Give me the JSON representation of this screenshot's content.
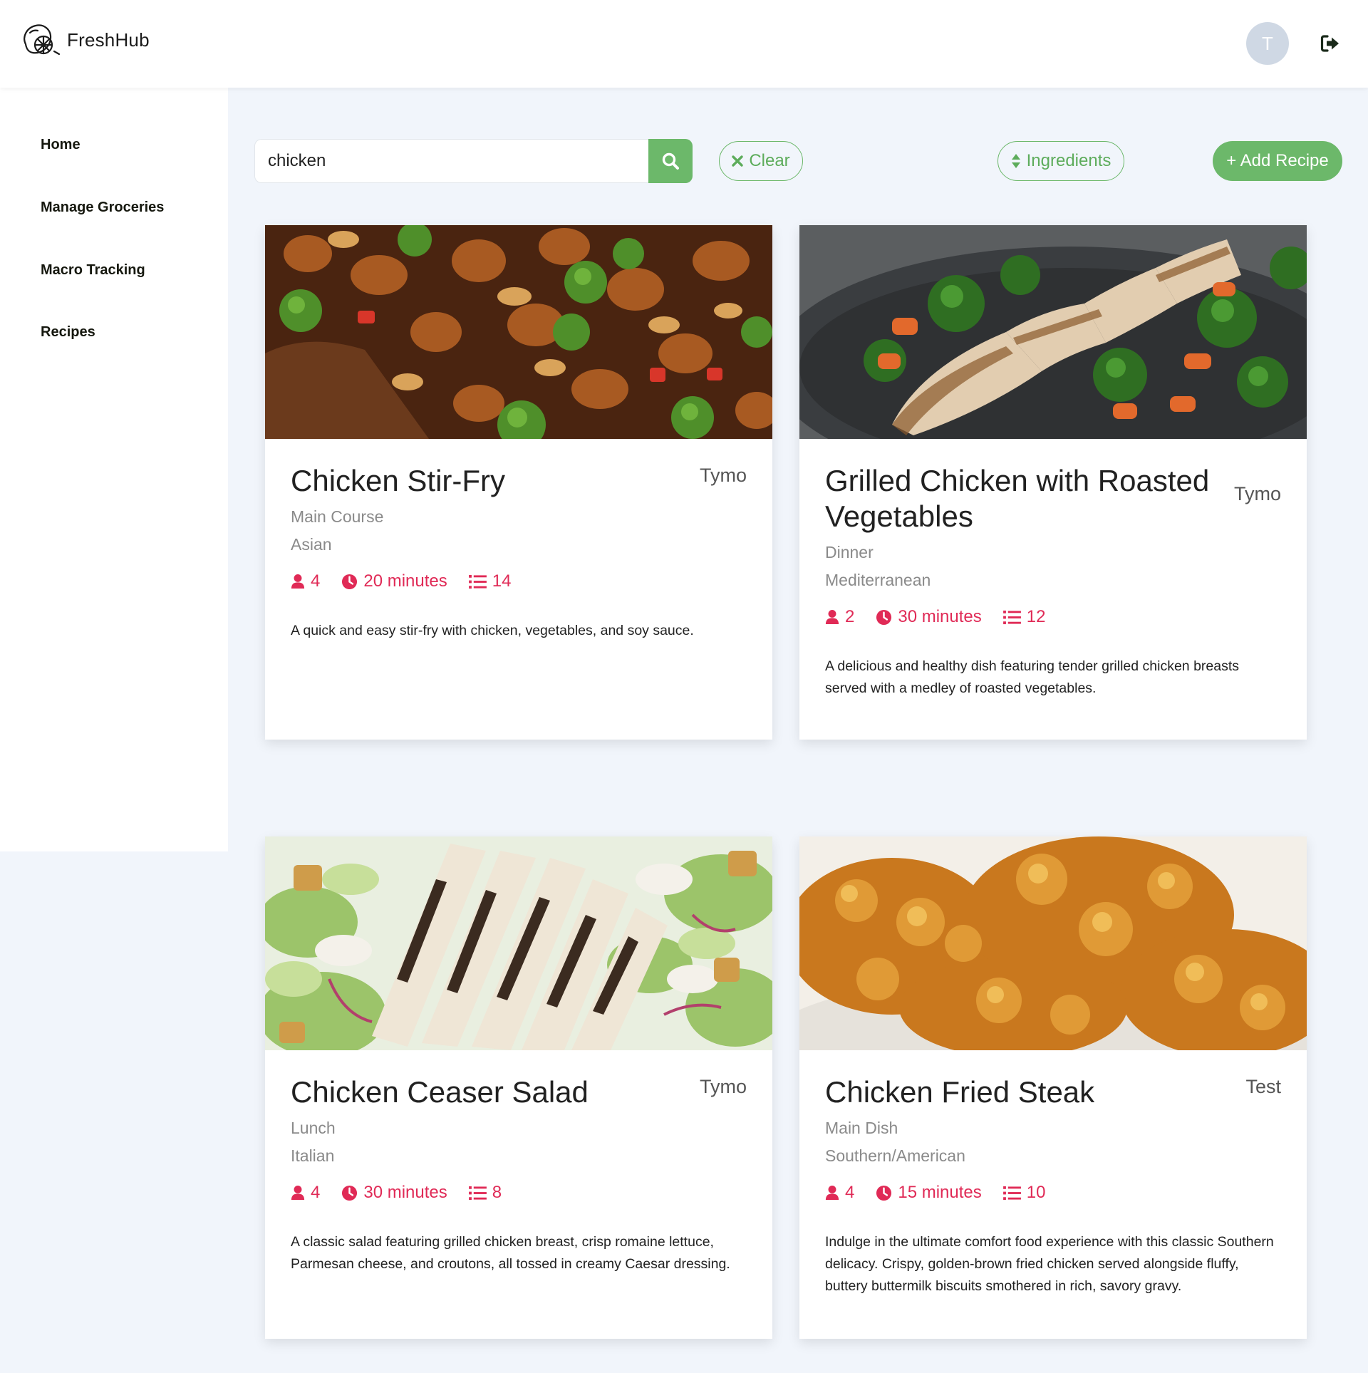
{
  "app": {
    "name": "FreshHub",
    "user_initial": "T"
  },
  "sidebar": {
    "items": [
      {
        "label": "Home"
      },
      {
        "label": "Manage Groceries"
      },
      {
        "label": "Macro Tracking"
      },
      {
        "label": "Recipes"
      }
    ]
  },
  "toolbar": {
    "search_value": "chicken",
    "clear_label": "Clear",
    "ingredients_label": "Ingredients",
    "add_label": "+ Add Recipe"
  },
  "recipes": [
    {
      "title": "Chicken Stir-Fry",
      "author": "Tymo",
      "category": "Main Course",
      "cuisine": "Asian",
      "servings": "4",
      "time": "20 minutes",
      "ingredients": "14",
      "description": "A quick and easy stir-fry with chicken, vegetables, and soy sauce."
    },
    {
      "title": "Grilled Chicken with Roasted Vegetables",
      "author": "Tymo",
      "category": "Dinner",
      "cuisine": "Mediterranean",
      "servings": "2",
      "time": "30 minutes",
      "ingredients": "12",
      "description": "A delicious and healthy dish featuring tender grilled chicken breasts served with a medley of roasted vegetables."
    },
    {
      "title": "Chicken Ceaser Salad",
      "author": "Tymo",
      "category": "Lunch",
      "cuisine": "Italian",
      "servings": "4",
      "time": "30 minutes",
      "ingredients": "8",
      "description": "A classic salad featuring grilled chicken breast, crisp romaine lettuce, Parmesan cheese, and croutons, all tossed in creamy Caesar dressing."
    },
    {
      "title": "Chicken Fried Steak",
      "author": "Test",
      "category": "Main Dish",
      "cuisine": "Southern/American",
      "servings": "4",
      "time": "15 minutes",
      "ingredients": "10",
      "description": "Indulge in the ultimate comfort food experience with this classic Southern delicacy. Crispy, golden-brown fried chicken served alongside fluffy, buttery buttermilk biscuits smothered in rich, savory gravy."
    }
  ],
  "icons": {
    "logo": "lemon-logo-icon",
    "logout": "sign-out-icon",
    "search": "search-icon",
    "clear": "close-icon",
    "sort": "sort-icon",
    "servings": "user-icon",
    "time": "clock-icon",
    "ingredients": "list-icon"
  },
  "colors": {
    "accent_green": "#6cb86a",
    "stat_pink": "#e02a56",
    "page_bg": "#f1f5fb",
    "avatar_bg": "#cfd8e4"
  }
}
